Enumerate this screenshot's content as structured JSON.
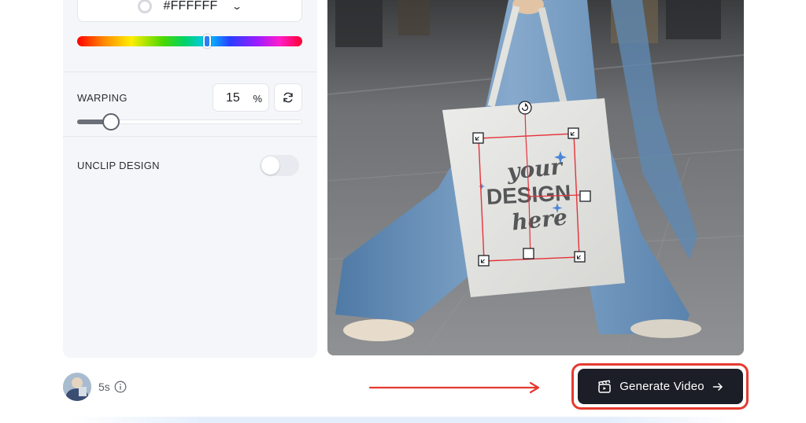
{
  "color_picker": {
    "hex_value": "#FFFFFF",
    "hue_handle_color": "#2f7cf6"
  },
  "warping": {
    "label": "WARPING",
    "value": "15",
    "unit": "%",
    "slider_fraction": 0.15
  },
  "unclip": {
    "label": "UNCLIP DESIGN",
    "enabled": false
  },
  "preview": {
    "design_line1": "your",
    "design_line2": "DESIGN",
    "design_line3": "here"
  },
  "footer": {
    "duration": "5s",
    "generate_label": "Generate Video"
  },
  "colors": {
    "accent_red": "#e53a2f",
    "button_dark": "#1b1e26",
    "panel_bg": "#f5f6f9"
  }
}
